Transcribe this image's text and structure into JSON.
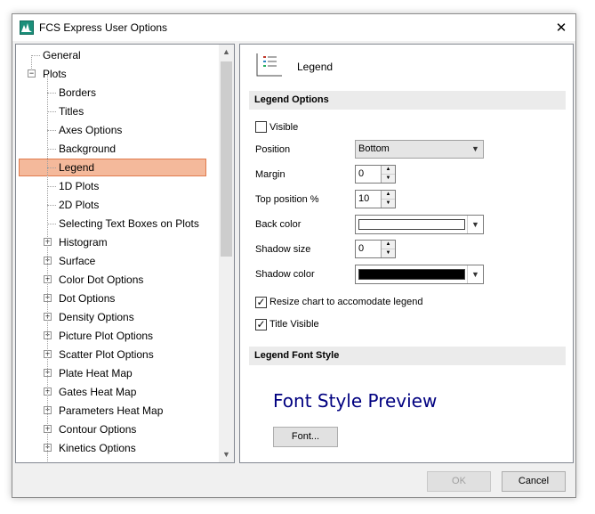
{
  "window": {
    "title": "FCS Express User Options",
    "close_glyph": "✕"
  },
  "tree": {
    "items": [
      {
        "label": "General",
        "level": 0,
        "expander": "none"
      },
      {
        "label": "Plots",
        "level": 0,
        "expander": "minus"
      },
      {
        "label": "Borders",
        "level": 1,
        "expander": "none"
      },
      {
        "label": "Titles",
        "level": 1,
        "expander": "none"
      },
      {
        "label": "Axes Options",
        "level": 1,
        "expander": "none"
      },
      {
        "label": "Background",
        "level": 1,
        "expander": "none"
      },
      {
        "label": "Legend",
        "level": 1,
        "expander": "none",
        "selected": true
      },
      {
        "label": "1D Plots",
        "level": 1,
        "expander": "none"
      },
      {
        "label": "2D Plots",
        "level": 1,
        "expander": "none"
      },
      {
        "label": "Selecting Text Boxes on Plots",
        "level": 1,
        "expander": "none"
      },
      {
        "label": "Histogram",
        "level": 1,
        "expander": "plus"
      },
      {
        "label": "Surface",
        "level": 1,
        "expander": "plus"
      },
      {
        "label": "Color Dot Options",
        "level": 1,
        "expander": "plus"
      },
      {
        "label": "Dot Options",
        "level": 1,
        "expander": "plus"
      },
      {
        "label": "Density Options",
        "level": 1,
        "expander": "plus"
      },
      {
        "label": "Picture Plot Options",
        "level": 1,
        "expander": "plus"
      },
      {
        "label": "Scatter Plot Options",
        "level": 1,
        "expander": "plus"
      },
      {
        "label": "Plate Heat Map",
        "level": 1,
        "expander": "plus"
      },
      {
        "label": "Gates Heat Map",
        "level": 1,
        "expander": "plus"
      },
      {
        "label": "Parameters Heat Map",
        "level": 1,
        "expander": "plus"
      },
      {
        "label": "Contour Options",
        "level": 1,
        "expander": "plus"
      },
      {
        "label": "Kinetics Options",
        "level": 1,
        "expander": "plus"
      }
    ]
  },
  "panel": {
    "title": "Legend",
    "icon": "legend-icon",
    "legend_options_header": "Legend Options",
    "visible_label": "Visible",
    "visible_checked": false,
    "position_label": "Position",
    "position_value": "Bottom",
    "margin_label": "Margin",
    "margin_value": "0",
    "top_position_label": "Top position %",
    "top_position_value": "10",
    "back_color_label": "Back color",
    "back_color_value": "#ffffff",
    "shadow_size_label": "Shadow size",
    "shadow_size_value": "0",
    "shadow_color_label": "Shadow color",
    "shadow_color_value": "#000000",
    "resize_label": "Resize chart to accomodate legend",
    "resize_checked": true,
    "title_visible_label": "Title Visible",
    "title_visible_checked": true,
    "font_style_header": "Legend Font Style",
    "font_preview": "Font Style Preview",
    "font_button": "Font..."
  },
  "buttons": {
    "ok": "OK",
    "cancel": "Cancel"
  },
  "check_glyph": "✓"
}
